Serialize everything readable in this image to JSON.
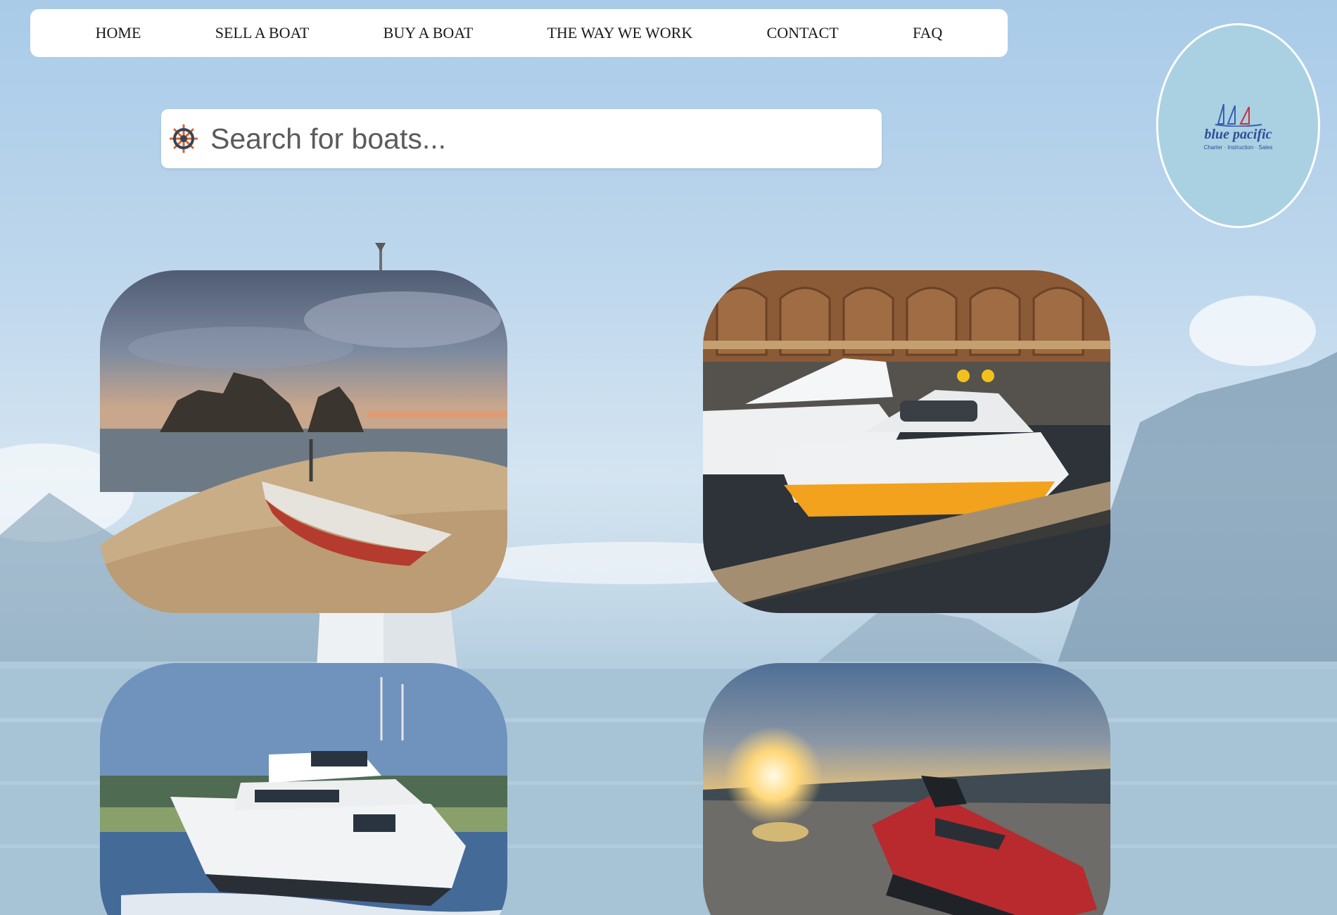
{
  "nav": {
    "items": [
      {
        "label": "HOME"
      },
      {
        "label": "SELL A BOAT"
      },
      {
        "label": "BUY A BOAT"
      },
      {
        "label": "THE WAY WE WORK"
      },
      {
        "label": "CONTACT"
      },
      {
        "label": "FAQ"
      }
    ]
  },
  "search": {
    "placeholder": "Search for boats...",
    "icon": "ship-wheel-icon"
  },
  "logo": {
    "brand": "blue pacific",
    "tagline": "Charter · Instruction · Sales"
  },
  "gallery": {
    "cards": [
      {
        "subject": "boat-on-sandy-beach"
      },
      {
        "subject": "yachts-at-marina-dock"
      },
      {
        "subject": "motor-yacht-cruising"
      },
      {
        "subject": "jet-ski-at-sunset"
      }
    ]
  },
  "colors": {
    "sky": "#a9cbe8",
    "nav_bg": "#ffffff",
    "logo_bg": "#a9d1e2",
    "logo_text": "#2f4e9a",
    "wheel_accent": "#d9622b"
  }
}
